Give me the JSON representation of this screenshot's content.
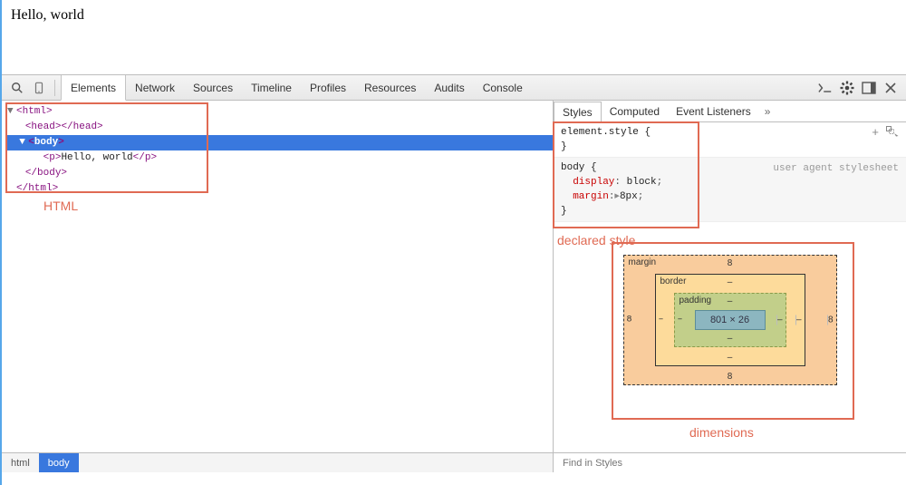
{
  "page": {
    "content": "Hello, world"
  },
  "toolbar": {
    "tabs": [
      "Elements",
      "Network",
      "Sources",
      "Timeline",
      "Profiles",
      "Resources",
      "Audits",
      "Console"
    ],
    "active_tab_index": 0
  },
  "dom": {
    "lines": [
      {
        "indent": 0,
        "tri": "▼",
        "open": "html",
        "close": "",
        "text": "",
        "selected": false
      },
      {
        "indent": 1,
        "tri": "",
        "open": "head",
        "close": "head",
        "text": "",
        "selected": false
      },
      {
        "indent": 1,
        "tri": "▼",
        "open": "body",
        "close": "",
        "text": "",
        "selected": true
      },
      {
        "indent": 2,
        "tri": "",
        "open": "p",
        "close": "p",
        "text": "Hello, world",
        "selected": false
      },
      {
        "indent": 1,
        "tri": "",
        "open": "",
        "close": "body",
        "text": "",
        "selected": false
      },
      {
        "indent": 0,
        "tri": "",
        "open": "",
        "close": "html",
        "text": "",
        "selected": false
      }
    ]
  },
  "right_tabs": {
    "items": [
      "Styles",
      "Computed",
      "Event Listeners"
    ],
    "active_index": 0,
    "overflow": "»"
  },
  "styles": {
    "element_style": {
      "selector": "element.style",
      "open": "{",
      "close": "}"
    },
    "body_rule": {
      "selector": "body",
      "open": "{",
      "close": "}",
      "lines": [
        {
          "prop": "display",
          "val": "block"
        },
        {
          "prop": "margin",
          "tri": "▸",
          "val": "8px"
        }
      ],
      "source_label": "user agent stylesheet"
    }
  },
  "boxmodel": {
    "labels": {
      "margin": "margin",
      "border": "border",
      "padding": "padding"
    },
    "margin": {
      "top": "8",
      "right": "8",
      "bottom": "8",
      "left": "8"
    },
    "border": {
      "top": "–",
      "right": "–",
      "bottom": "–",
      "left": "–"
    },
    "padding": {
      "top": "–",
      "right": "–",
      "bottom": "–",
      "left": "–"
    },
    "content": "801 × 26"
  },
  "breadcrumb": {
    "items": [
      "html",
      "body"
    ],
    "active_index": 1
  },
  "find": {
    "placeholder": "Find in Styles"
  },
  "annotations": {
    "html_label": "HTML",
    "declared_label": "declared style",
    "dimensions_label": "dimensions"
  }
}
